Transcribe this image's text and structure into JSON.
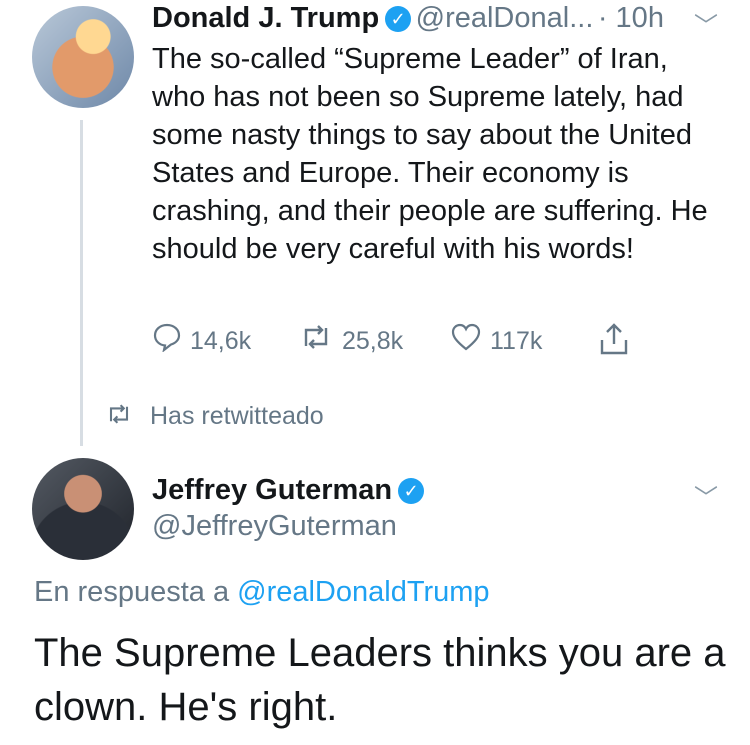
{
  "tweet1": {
    "name": "Donald J. Trump",
    "handle": "@realDonal...",
    "time": "· 10h",
    "text": "The so-called “Supreme Leader” of Iran, who has not been so Supreme lately, had some nasty things to say about the United States and Europe. Their economy is crashing, and their people are suffering. He should be very careful with his words!",
    "replies": "14,6k",
    "retweets": "25,8k",
    "likes": "117k"
  },
  "retweet_label": "Has retwitteado",
  "tweet2": {
    "name": "Jeffrey Guterman",
    "handle": "@JeffreyGuterman",
    "reply_prefix": "En respuesta a",
    "reply_handle": "@realDonaldTrump",
    "text": "The Supreme Leaders thinks you are a clown. He's right."
  },
  "icons": {
    "reply": "speech-bubble",
    "retweet": "retweet-arrows",
    "like": "heart-outline",
    "share": "share-up-arrow",
    "chevron": "chevron-down",
    "verified": "verified-check"
  },
  "colors": {
    "link": "#1da1f2",
    "muted": "#657786",
    "text": "#14171a"
  }
}
